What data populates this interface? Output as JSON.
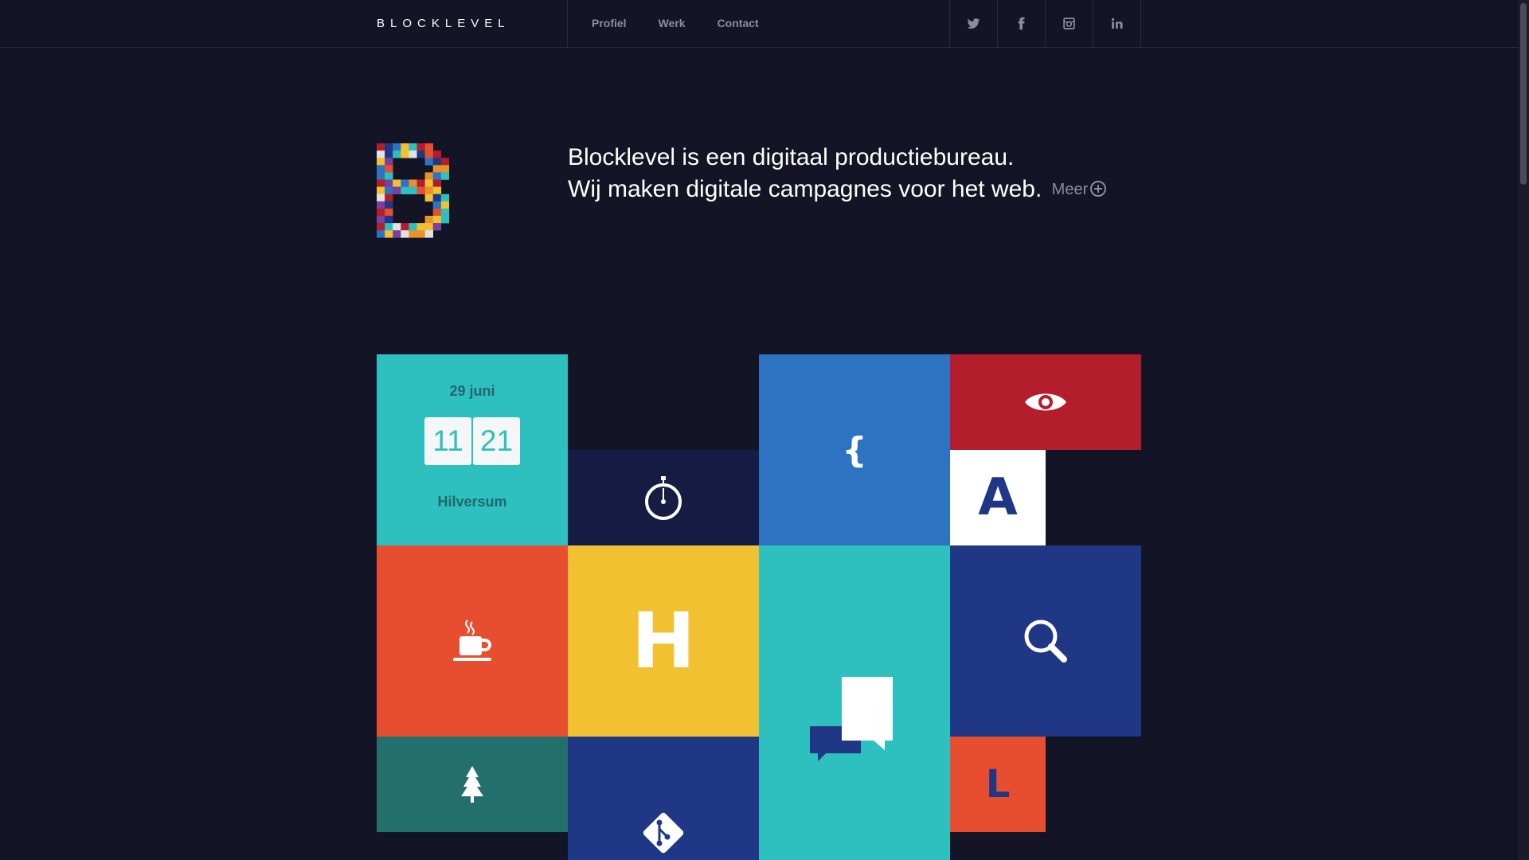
{
  "header": {
    "brand": "BLOCKLEVEL",
    "nav": [
      "Profiel",
      "Werk",
      "Contact"
    ],
    "social": [
      "twitter-icon",
      "facebook-icon",
      "instagram-icon",
      "linkedin-icon"
    ]
  },
  "intro": {
    "line1": "Blocklevel is een digitaal productiebureau.",
    "line2": "Wij maken digitale campagnes voor het web.",
    "more": "Meer"
  },
  "clock": {
    "date": "29 juni",
    "hours": "11",
    "minutes": "21",
    "city": "Hilversum"
  },
  "tiles": {
    "brace": "{",
    "letter_a": "A",
    "letter_h": "H",
    "letter_l": "L"
  },
  "colors": {
    "background": "#131425",
    "teal": "#2ebfbf",
    "navy": "#161c44",
    "blue": "#2e72c2",
    "red": "#b31d2c",
    "orange": "#e74e30",
    "yellow": "#f1c131",
    "dark_blue": "#1f3784",
    "dark_teal": "#236f6c",
    "white": "#ffffff"
  }
}
